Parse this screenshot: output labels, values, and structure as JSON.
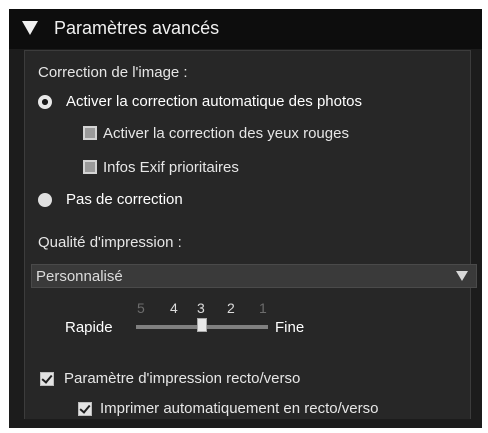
{
  "header": {
    "title": "Paramètres avancés"
  },
  "image_correction": {
    "label": "Correction de l'image :",
    "auto_option": "Activer la correction automatique des photos",
    "red_eye": "Activer la correction des yeux rouges",
    "exif_priority": "Infos Exif prioritaires",
    "no_correction": "Pas de correction",
    "selected": "auto"
  },
  "print_quality": {
    "label": "Qualité d'impression :",
    "selected_value": "Personnalisé",
    "slider": {
      "ticks": [
        "5",
        "4",
        "3",
        "2",
        "1"
      ],
      "value": 3,
      "left_label": "Rapide",
      "right_label": "Fine"
    }
  },
  "duplex": {
    "setting_label": "Paramètre d'impression recto/verso",
    "setting_checked": true,
    "auto_label": "Imprimer automatiquement en recto/verso",
    "auto_checked": true
  }
}
